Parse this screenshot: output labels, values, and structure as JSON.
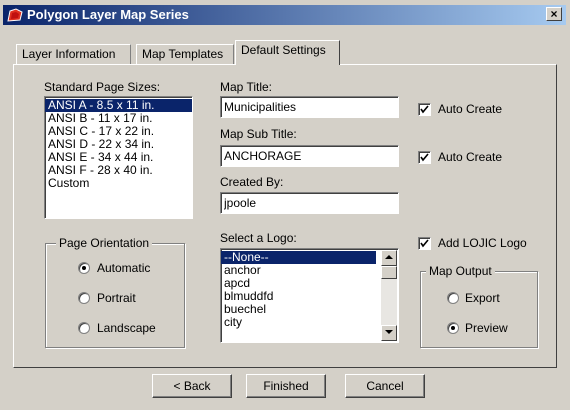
{
  "window": {
    "title": "Polygon Layer Map Series",
    "close_label": "×"
  },
  "tabs": [
    {
      "label": "Layer Information"
    },
    {
      "label": "Map Templates"
    },
    {
      "label": "Default Settings"
    }
  ],
  "page_sizes": {
    "label": "Standard Page Sizes:",
    "items": [
      "ANSI A - 8.5 x 11 in.",
      "ANSI B - 11 x 17 in.",
      "ANSI C - 17 x 22 in.",
      "ANSI D - 22 x 34 in.",
      "ANSI E - 34 x 44 in.",
      "ANSI F - 28 x 40 in.",
      "Custom"
    ],
    "selected": "ANSI A - 8.5 x 11 in."
  },
  "orientation": {
    "label": "Page Orientation",
    "options": [
      "Automatic",
      "Portrait",
      "Landscape"
    ],
    "selected": "Automatic"
  },
  "map_title": {
    "label": "Map Title:",
    "value": "Municipalities",
    "auto_create_label": "Auto Create",
    "auto_create": true
  },
  "map_subtitle": {
    "label": "Map Sub Title:",
    "value": "ANCHORAGE",
    "auto_create_label": "Auto Create",
    "auto_create": true
  },
  "created_by": {
    "label": "Created By:",
    "value": "jpoole"
  },
  "logo": {
    "label": "Select a Logo:",
    "items": [
      "--None--",
      "anchor",
      "apcd",
      "blmuddfd",
      "buechel",
      "city"
    ],
    "selected": "--None--"
  },
  "add_logo": {
    "label": "Add LOJIC Logo",
    "checked": true
  },
  "map_output": {
    "label": "Map Output",
    "options": [
      "Export",
      "Preview"
    ],
    "selected": "Preview"
  },
  "buttons": {
    "back": "< Back",
    "finished": "Finished",
    "cancel": "Cancel"
  },
  "colors": {
    "title_start": "#0a246a",
    "title_end": "#a6caf0",
    "selection": "#0a246a",
    "face": "#d4d0c8"
  }
}
